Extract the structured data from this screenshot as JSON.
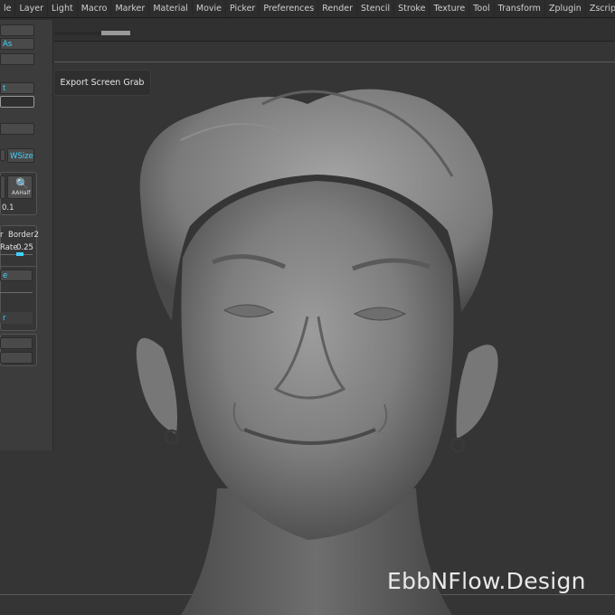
{
  "menu": [
    "le",
    "Layer",
    "Light",
    "Macro",
    "Marker",
    "Material",
    "Movie",
    "Picker",
    "Preferences",
    "Render",
    "Stencil",
    "Stroke",
    "Texture",
    "Tool",
    "Transform",
    "Zplugin",
    "Zscript"
  ],
  "panel": {
    "save_as": "As",
    "export": "t",
    "wsize": "WSize",
    "aahalf_value": "0.1",
    "aahalf_icon": "AAHalf",
    "border_label": "r",
    "border2": "Border2",
    "rate_label": "Rate",
    "rate_value": "0.25",
    "cyan_item": "e",
    "cyan_item2": "r"
  },
  "tooltip": "Export Screen Grab",
  "watermark": "EbbNFlow.Design",
  "colors": {
    "background": "#353535",
    "accent": "#3fd2ff",
    "panel": "#3c3c3c"
  }
}
